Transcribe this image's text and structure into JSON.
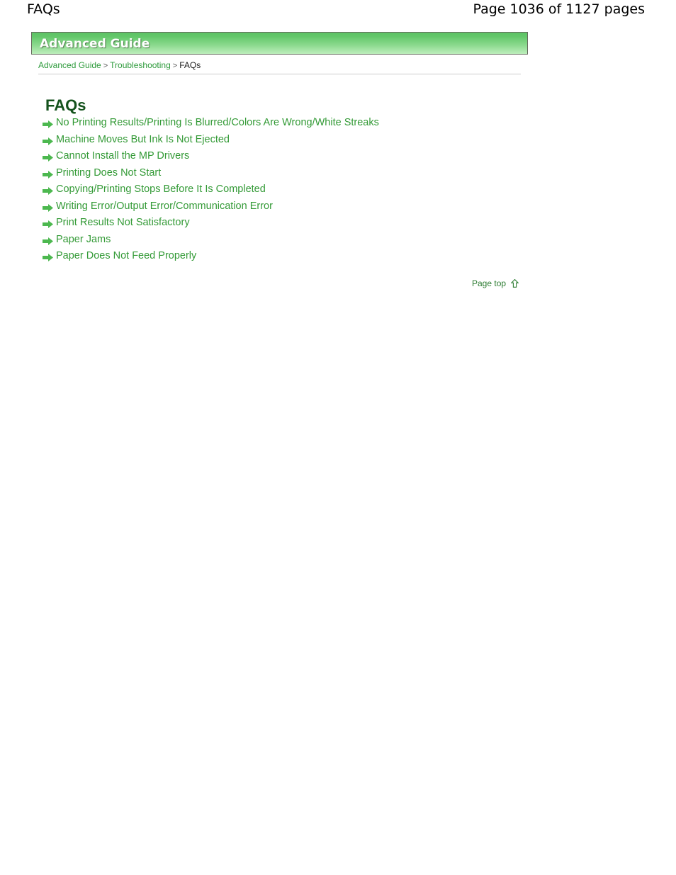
{
  "page_header": {
    "doc_title": "FAQs",
    "page_count": "Page 1036 of 1127 pages"
  },
  "banner": {
    "title": "Advanced Guide",
    "gradient_top": "#5cc264",
    "gradient_bottom": "#bdeebc",
    "border_color": "#666b5e"
  },
  "breadcrumb": {
    "items": [
      {
        "label": "Advanced Guide",
        "type": "link"
      },
      {
        "label": "Troubleshooting",
        "type": "link"
      },
      {
        "label": "FAQs",
        "type": "current"
      }
    ],
    "separator": ">"
  },
  "main": {
    "heading": "FAQs",
    "heading_color": "#14521c",
    "link_color": "#339a36",
    "bullet_icon": "arrow-right-icon",
    "faqs": [
      {
        "label": "No Printing Results/Printing Is Blurred/Colors Are Wrong/White Streaks"
      },
      {
        "label": "Machine Moves But Ink Is Not Ejected"
      },
      {
        "label": "Cannot Install the MP Drivers"
      },
      {
        "label": "Printing Does Not Start"
      },
      {
        "label": "Copying/Printing Stops Before It Is Completed"
      },
      {
        "label": "Writing Error/Output Error/Communication Error"
      },
      {
        "label": "Print Results Not Satisfactory"
      },
      {
        "label": "Paper Jams"
      },
      {
        "label": "Paper Does Not Feed Properly"
      }
    ]
  },
  "footer": {
    "page_top_label": "Page top",
    "page_top_icon": "arrow-up-icon"
  }
}
